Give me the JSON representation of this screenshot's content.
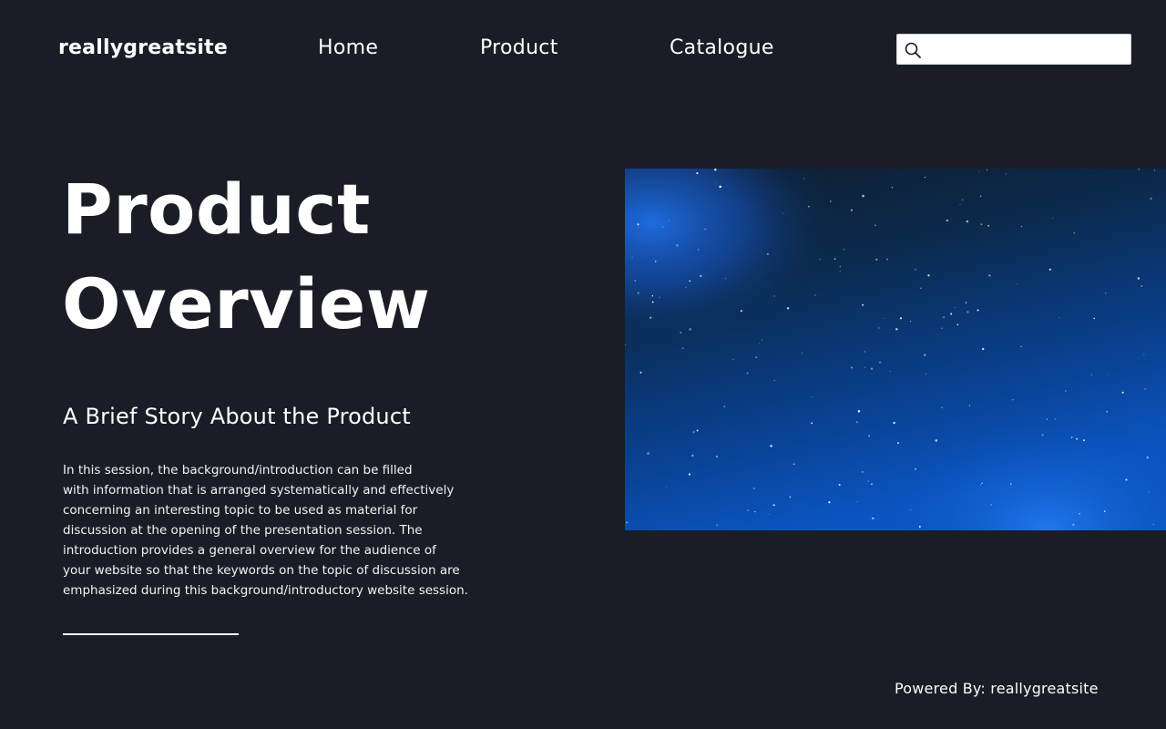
{
  "header": {
    "logo": "reallygreatsite",
    "nav": [
      {
        "label": "Home"
      },
      {
        "label": "Product"
      },
      {
        "label": "Catalogue"
      }
    ],
    "search": {
      "icon": "search-icon",
      "value": "",
      "placeholder": ""
    }
  },
  "hero": {
    "title_lines": [
      "Product",
      "Overview"
    ],
    "subtitle": "A Brief Story About the Product",
    "description_lines": [
      "In this session, the background/introduction can be filled",
      "with information that is arranged systematically and effectively",
      "concerning an interesting topic to be used as material for",
      "discussion at the opening of the presentation session. The",
      "introduction provides a general overview for the audience of",
      "your website so that the keywords on the topic of discussion are",
      "emphasized during this background/introductory website session."
    ]
  },
  "footer": {
    "powered_by": "Powered By: reallygreatsite"
  },
  "colors": {
    "background": "#1a1d26",
    "text": "#ffffff",
    "image_sky_top": "#0f1a2a",
    "image_sky_bottom": "#0b4fb5"
  }
}
